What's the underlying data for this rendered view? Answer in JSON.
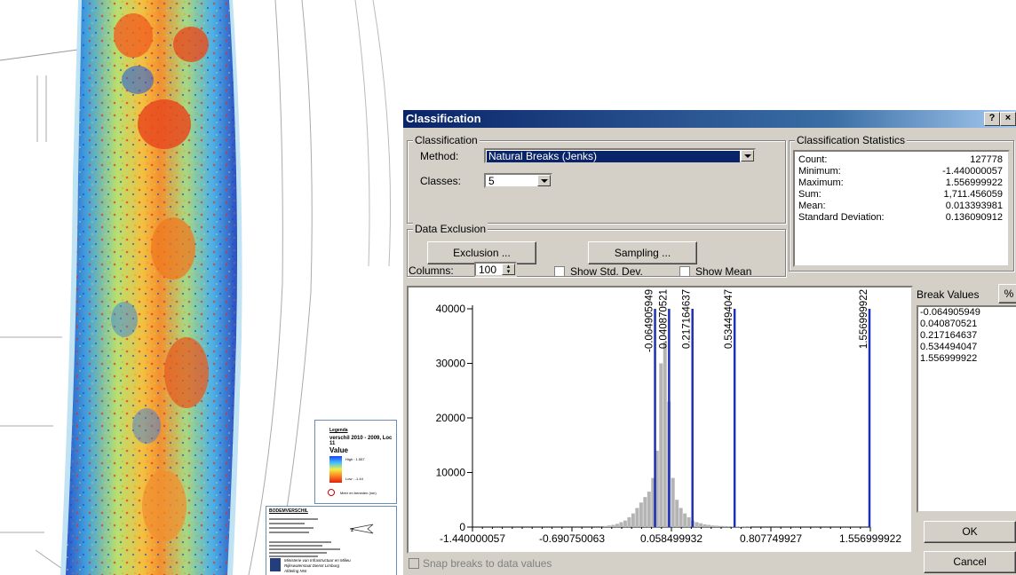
{
  "map": {
    "legend": {
      "heading": "Legenda",
      "title": "verschil 2010 - 2009, Loc 11",
      "value_label": "Value",
      "high": "High : 1.557",
      "low": "Low : -1.44",
      "note": "Meer en beneden (nm)"
    },
    "info": {
      "title": "BODEMVERSCHIL",
      "ministry": "Ministerie van Infrastructuur en Milieu",
      "rws": "Rijkswaterstaat Dienst Limburg",
      "dept": "Afdeling NNI"
    }
  },
  "dialog": {
    "title": "Classification",
    "help_btn": "?",
    "close_btn": "×",
    "classification_group": "Classification",
    "method_label": "Method:",
    "method_value": "Natural Breaks (Jenks)",
    "classes_label": "Classes:",
    "classes_value": "5",
    "exclusion_group": "Data Exclusion",
    "exclusion_btn": "Exclusion ...",
    "sampling_btn": "Sampling ...",
    "stats_group": "Classification Statistics",
    "stats": [
      {
        "k": "Count:",
        "v": "127778"
      },
      {
        "k": "Minimum:",
        "v": "-1.440000057"
      },
      {
        "k": "Maximum:",
        "v": "1.556999922"
      },
      {
        "k": "Sum:",
        "v": "1,711.456059"
      },
      {
        "k": "Mean:",
        "v": "0.013393981"
      },
      {
        "k": "Standard Deviation:",
        "v": "0.136090912"
      }
    ],
    "columns_label": "Columns:",
    "columns_value": "100",
    "show_std_dev": "Show Std. Dev.",
    "show_mean": "Show Mean",
    "break_values_label": "Break Values",
    "percent_btn": "%",
    "break_values": [
      "-0.064905949",
      "0.040870521",
      "0.217164637",
      "0.534494047",
      "1.556999922"
    ],
    "ok_btn": "OK",
    "cancel_btn": "Cancel",
    "snap_label": "Snap breaks to data values"
  },
  "chart_data": {
    "type": "bar",
    "title": "",
    "xlabel": "",
    "ylabel": "",
    "xlim": [
      -1.440000057,
      1.556999922
    ],
    "ylim": [
      0,
      40000
    ],
    "y_ticks": [
      "40000",
      "30000",
      "20000",
      "10000",
      "0"
    ],
    "y_tick_values": [
      40000,
      30000,
      20000,
      10000,
      0
    ],
    "x_ticks": [
      "-1.440000057",
      "-0.690750063",
      "0.058499932",
      "0.807749927",
      "1.556999922"
    ],
    "x_tick_values": [
      -1.440000057,
      -0.690750063,
      0.058499932,
      0.807749927,
      1.556999922
    ],
    "bar_color": "#b4b4b4",
    "break_color": "#1e2fb4",
    "break_values": [
      -0.064905949,
      0.040870521,
      0.217164637,
      0.534494047,
      1.556999922
    ],
    "break_labels": [
      "-0.064905949",
      "0.040870521",
      "0.217164637",
      "0.534494047",
      "1.556999922"
    ],
    "bins_x": [
      -0.44,
      -0.41,
      -0.38,
      -0.35,
      -0.32,
      -0.29,
      -0.26,
      -0.23,
      -0.2,
      -0.17,
      -0.14,
      -0.11,
      -0.08,
      -0.05,
      -0.02,
      0.01,
      0.04,
      0.07,
      0.1,
      0.13,
      0.16,
      0.19,
      0.22,
      0.25,
      0.28,
      0.31,
      0.34,
      0.37,
      0.4,
      0.43,
      0.46,
      0.49,
      0.52,
      0.55,
      0.58,
      0.61,
      0.64
    ],
    "bins_y": [
      200,
      300,
      400,
      600,
      900,
      1200,
      1800,
      2500,
      3500,
      4500,
      5500,
      6500,
      9000,
      14000,
      30000,
      34000,
      23000,
      9000,
      5000,
      3500,
      2500,
      1800,
      1200,
      900,
      700,
      500,
      400,
      300,
      250,
      200,
      180,
      150,
      120,
      100,
      80,
      60,
      50
    ]
  }
}
